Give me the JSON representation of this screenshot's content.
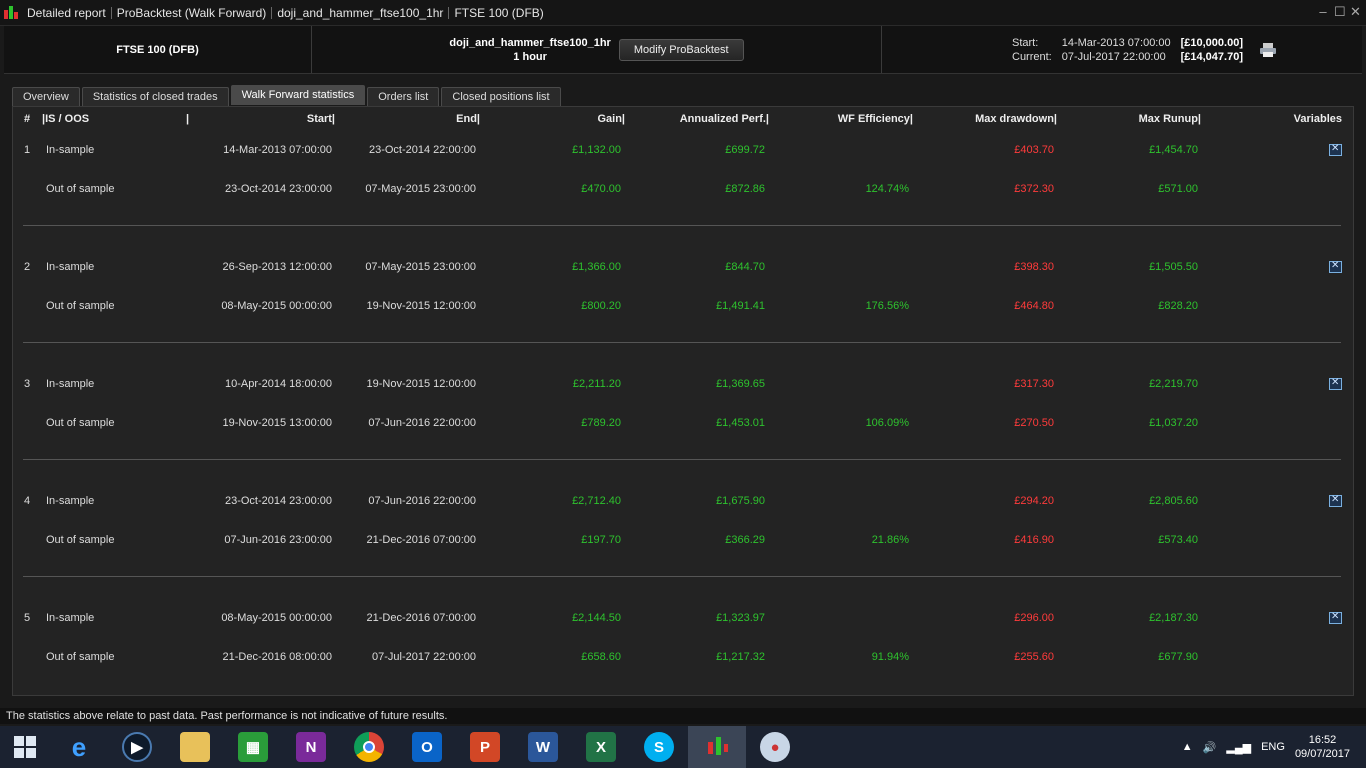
{
  "titlebar": {
    "crumbs": [
      "Detailed report",
      "ProBacktest (Walk Forward)",
      "doji_and_hammer_ftse100_1hr",
      "FTSE 100 (DFB)"
    ]
  },
  "header": {
    "instrument": "FTSE 100 (DFB)",
    "strategy_name": "doji_and_hammer_ftse100_1hr",
    "timeframe": "1 hour",
    "modify_button": "Modify ProBacktest",
    "start_label": "Start:",
    "start_date": "14-Mar-2013 07:00:00",
    "start_capital": "[£10,000.00]",
    "current_label": "Current:",
    "current_date": "07-Jul-2017 22:00:00",
    "current_capital": "[£14,047.70]"
  },
  "tabs": [
    {
      "label": "Overview"
    },
    {
      "label": "Statistics of closed trades"
    },
    {
      "label": "Walk Forward statistics"
    },
    {
      "label": "Orders list"
    },
    {
      "label": "Closed positions list"
    }
  ],
  "columns": {
    "num": "#",
    "isoos": "|IS / OOS",
    "bar": "|",
    "start": "Start|",
    "end": "End|",
    "gain": "Gain|",
    "annualized": "Annualized Perf.|",
    "wf": "WF Efficiency|",
    "dd": "Max drawdown|",
    "runup": "Max Runup|",
    "vars": "Variables"
  },
  "periods": [
    {
      "num": "1",
      "is": {
        "label": "In-sample",
        "start": "14-Mar-2013 07:00:00",
        "end": "23-Oct-2014 22:00:00",
        "gain": "£1,132.00",
        "annualized": "£699.72",
        "dd": "£403.70",
        "runup": "£1,454.70"
      },
      "oos": {
        "label": "Out of sample",
        "start": "23-Oct-2014 23:00:00",
        "end": "07-May-2015 23:00:00",
        "gain": "£470.00",
        "annualized": "£872.86",
        "wf": "124.74%",
        "dd": "£372.30",
        "runup": "£571.00"
      }
    },
    {
      "num": "2",
      "is": {
        "label": "In-sample",
        "start": "26-Sep-2013 12:00:00",
        "end": "07-May-2015 23:00:00",
        "gain": "£1,366.00",
        "annualized": "£844.70",
        "dd": "£398.30",
        "runup": "£1,505.50"
      },
      "oos": {
        "label": "Out of sample",
        "start": "08-May-2015 00:00:00",
        "end": "19-Nov-2015 12:00:00",
        "gain": "£800.20",
        "annualized": "£1,491.41",
        "wf": "176.56%",
        "dd": "£464.80",
        "runup": "£828.20"
      }
    },
    {
      "num": "3",
      "is": {
        "label": "In-sample",
        "start": "10-Apr-2014 18:00:00",
        "end": "19-Nov-2015 12:00:00",
        "gain": "£2,211.20",
        "annualized": "£1,369.65",
        "dd": "£317.30",
        "runup": "£2,219.70"
      },
      "oos": {
        "label": "Out of sample",
        "start": "19-Nov-2015 13:00:00",
        "end": "07-Jun-2016 22:00:00",
        "gain": "£789.20",
        "annualized": "£1,453.01",
        "wf": "106.09%",
        "dd": "£270.50",
        "runup": "£1,037.20"
      }
    },
    {
      "num": "4",
      "is": {
        "label": "In-sample",
        "start": "23-Oct-2014 23:00:00",
        "end": "07-Jun-2016 22:00:00",
        "gain": "£2,712.40",
        "annualized": "£1,675.90",
        "dd": "£294.20",
        "runup": "£2,805.60"
      },
      "oos": {
        "label": "Out of sample",
        "start": "07-Jun-2016 23:00:00",
        "end": "21-Dec-2016 07:00:00",
        "gain": "£197.70",
        "annualized": "£366.29",
        "wf": "21.86%",
        "dd": "£416.90",
        "runup": "£573.40"
      }
    },
    {
      "num": "5",
      "is": {
        "label": "In-sample",
        "start": "08-May-2015 00:00:00",
        "end": "21-Dec-2016 07:00:00",
        "gain": "£2,144.50",
        "annualized": "£1,323.97",
        "dd": "£296.00",
        "runup": "£2,187.30"
      },
      "oos": {
        "label": "Out of sample",
        "start": "21-Dec-2016 08:00:00",
        "end": "07-Jul-2017 22:00:00",
        "gain": "£658.60",
        "annualized": "£1,217.32",
        "wf": "91.94%",
        "dd": "£255.60",
        "runup": "£677.90"
      }
    }
  ],
  "footer": {
    "disclaimer": "The statistics above relate to past data. Past performance is not indicative of future results."
  },
  "taskbar": {
    "language": "ENG",
    "time": "16:52",
    "date": "09/07/2017"
  },
  "colors": {
    "positive": "#2ec22e",
    "negative": "#ff3b3b"
  }
}
